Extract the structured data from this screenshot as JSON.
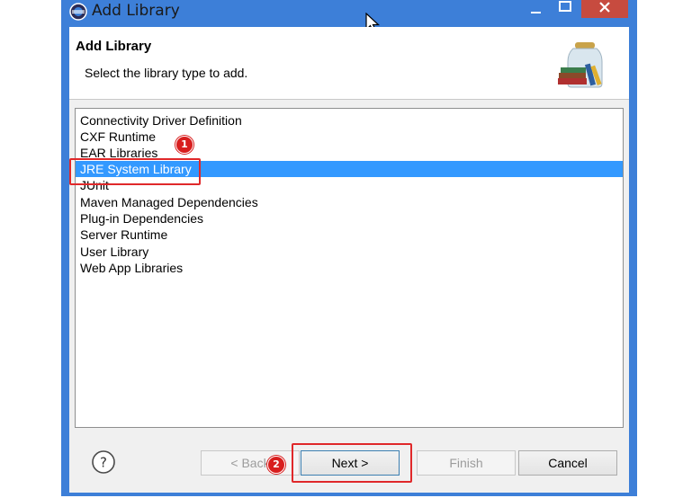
{
  "window": {
    "title": "Add Library"
  },
  "header": {
    "title": "Add Library",
    "subtitle": "Select the library type to add."
  },
  "library_types": [
    {
      "label": "Connectivity Driver Definition",
      "selected": false
    },
    {
      "label": "CXF Runtime",
      "selected": false
    },
    {
      "label": "EAR Libraries",
      "selected": false
    },
    {
      "label": "JRE System Library",
      "selected": true
    },
    {
      "label": "JUnit",
      "selected": false
    },
    {
      "label": "Maven Managed Dependencies",
      "selected": false
    },
    {
      "label": "Plug-in Dependencies",
      "selected": false
    },
    {
      "label": "Server Runtime",
      "selected": false
    },
    {
      "label": "User Library",
      "selected": false
    },
    {
      "label": "Web App Libraries",
      "selected": false
    }
  ],
  "buttons": {
    "help": "?",
    "back": "< Back",
    "next": "Next >",
    "finish": "Finish",
    "cancel": "Cancel"
  },
  "annotations": {
    "step1": "1",
    "step2": "2"
  },
  "colors": {
    "titlebar": "#3d7fd8",
    "selection": "#3399ff",
    "annotation_red": "#e0282a",
    "close_button": "#c74b3f"
  }
}
